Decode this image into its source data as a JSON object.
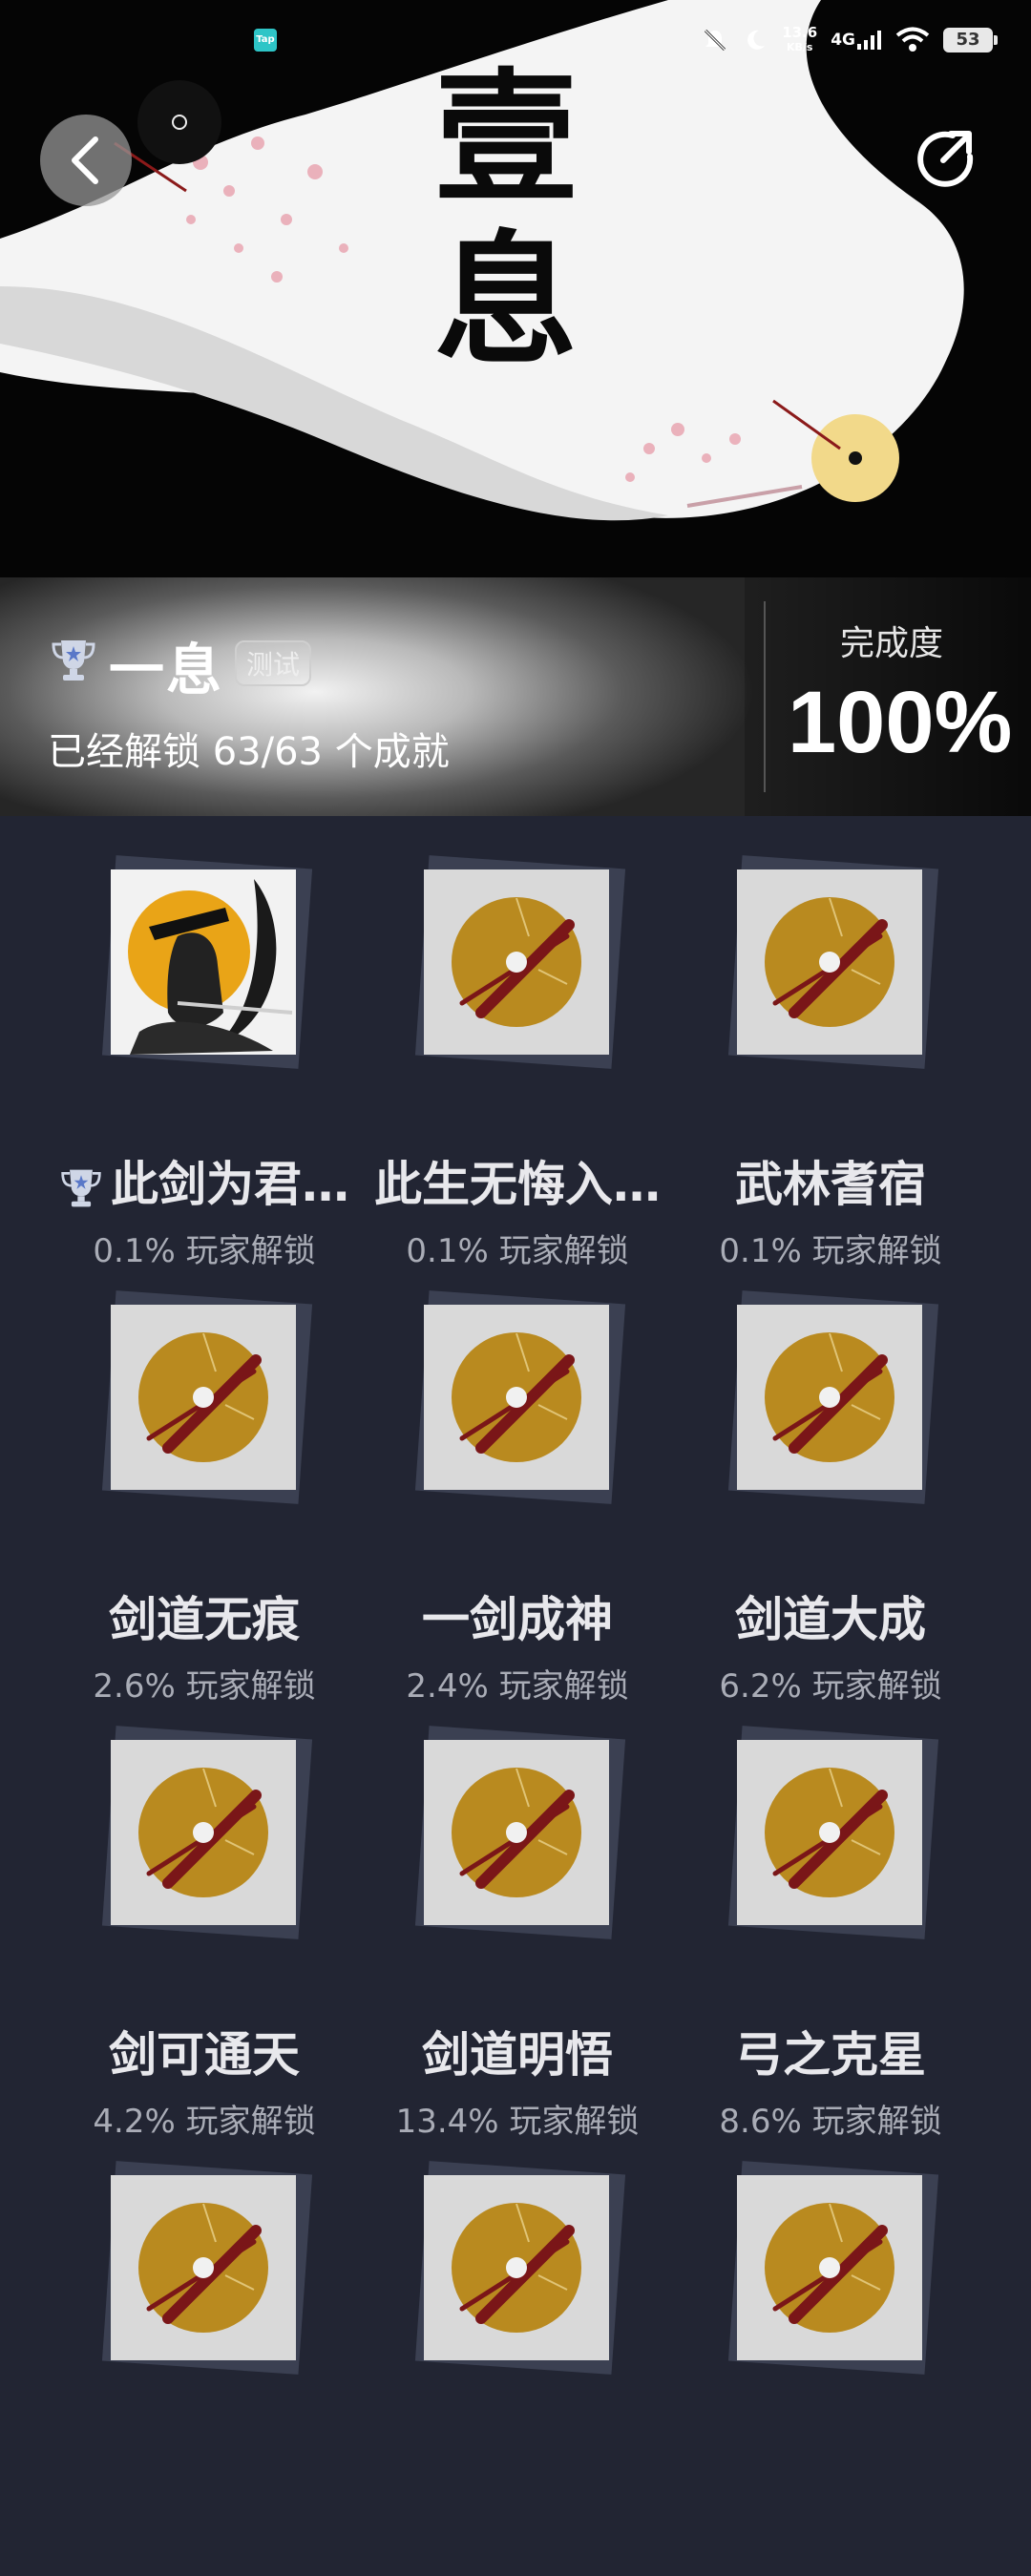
{
  "statusbar": {
    "app_badge": "Tap",
    "net_speed_value": "13.6",
    "net_speed_unit": "KB/s",
    "network": "4G",
    "battery": "53"
  },
  "header": {
    "title_chars": [
      "壹",
      "息"
    ]
  },
  "game": {
    "name": "一息",
    "badge": "测试",
    "unlocked_text": "已经解锁 63/63 个成就",
    "completion_label": "完成度",
    "completion_value": "100%"
  },
  "achievements": [
    {
      "name": "此剑为君…",
      "percent": "0.1% 玩家解锁",
      "has_trophy": true,
      "special_icon": true
    },
    {
      "name": "此生无悔入…",
      "percent": "0.1% 玩家解锁"
    },
    {
      "name": "武林耆宿",
      "percent": "0.1% 玩家解锁"
    },
    {
      "name": "剑道无痕",
      "percent": "2.6% 玩家解锁"
    },
    {
      "name": "一剑成神",
      "percent": "2.4% 玩家解锁"
    },
    {
      "name": "剑道大成",
      "percent": "6.2% 玩家解锁"
    },
    {
      "name": "剑可通天",
      "percent": "4.2% 玩家解锁"
    },
    {
      "name": "剑道明悟",
      "percent": "13.4% 玩家解锁"
    },
    {
      "name": "弓之克星",
      "percent": "8.6% 玩家解锁"
    },
    {
      "name": "",
      "percent": ""
    },
    {
      "name": "",
      "percent": ""
    },
    {
      "name": "",
      "percent": ""
    }
  ],
  "icons": {
    "back": "back-arrow-icon",
    "share": "share-icon",
    "trophy": "trophy-icon"
  },
  "colors": {
    "page_bg": "#222533",
    "icon_gold": "#b98a1f",
    "slash_red": "#7a1618"
  }
}
